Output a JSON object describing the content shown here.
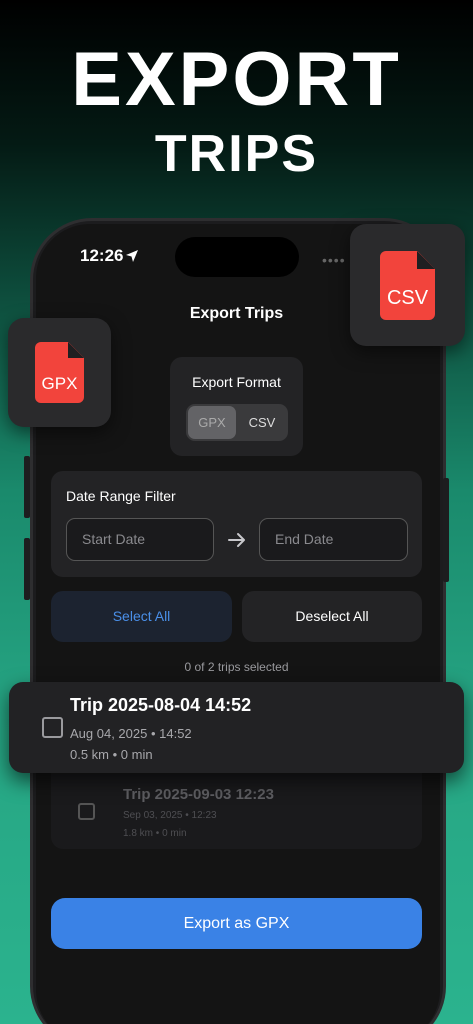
{
  "hero": {
    "title": "EXPORT",
    "subtitle": "TRIPS"
  },
  "status_bar": {
    "time": "12:26"
  },
  "nav": {
    "title": "Export Trips"
  },
  "badges": {
    "gpx_label": "GPX",
    "csv_label": "CSV",
    "file_color": "#f2443c"
  },
  "export_format": {
    "title": "Export Format",
    "options": [
      "GPX",
      "CSV"
    ],
    "selected": "GPX"
  },
  "date_range": {
    "title": "Date Range Filter",
    "start_placeholder": "Start Date",
    "end_placeholder": "End Date"
  },
  "selection": {
    "select_all": "Select All",
    "deselect_all": "Deselect All",
    "count_text": "0 of 2 trips selected"
  },
  "trips": [
    {
      "title": "Trip 2025-08-04 14:52",
      "date": "Aug 04, 2025 • 14:52",
      "stats": "0.5 km • 0 min",
      "checked": false
    },
    {
      "title": "Trip 2025-09-03 12:23",
      "date": "Sep 03, 2025 • 12:23",
      "stats": "1.8 km • 0 min",
      "checked": false
    }
  ],
  "export_button": {
    "label": "Export as GPX",
    "color": "#3a82e6"
  }
}
